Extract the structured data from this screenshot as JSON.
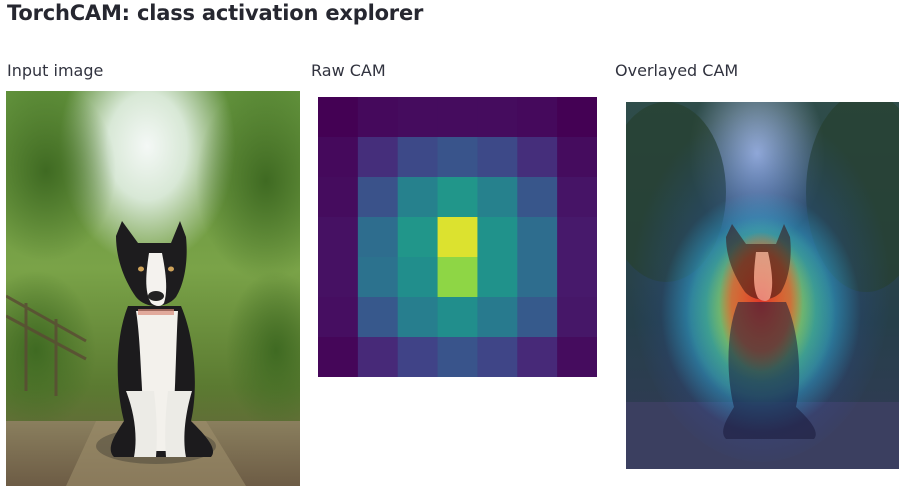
{
  "header": {
    "title": "TorchCAM: class activation explorer"
  },
  "columns": {
    "input_label": "Input image",
    "raw_label": "Raw CAM",
    "overlay_label": "Overlayed CAM"
  },
  "raw_cam": {
    "rows": 7,
    "cols": 7,
    "colormap": "viridis",
    "values": [
      [
        0.0,
        0.03,
        0.04,
        0.04,
        0.04,
        0.03,
        0.0
      ],
      [
        0.03,
        0.17,
        0.28,
        0.33,
        0.28,
        0.17,
        0.04
      ],
      [
        0.04,
        0.32,
        0.55,
        0.66,
        0.55,
        0.34,
        0.07
      ],
      [
        0.06,
        0.45,
        0.66,
        0.97,
        0.64,
        0.45,
        0.09
      ],
      [
        0.06,
        0.47,
        0.62,
        0.9,
        0.64,
        0.45,
        0.09
      ],
      [
        0.05,
        0.35,
        0.53,
        0.62,
        0.51,
        0.36,
        0.08
      ],
      [
        0.02,
        0.15,
        0.25,
        0.33,
        0.26,
        0.15,
        0.04
      ]
    ]
  }
}
